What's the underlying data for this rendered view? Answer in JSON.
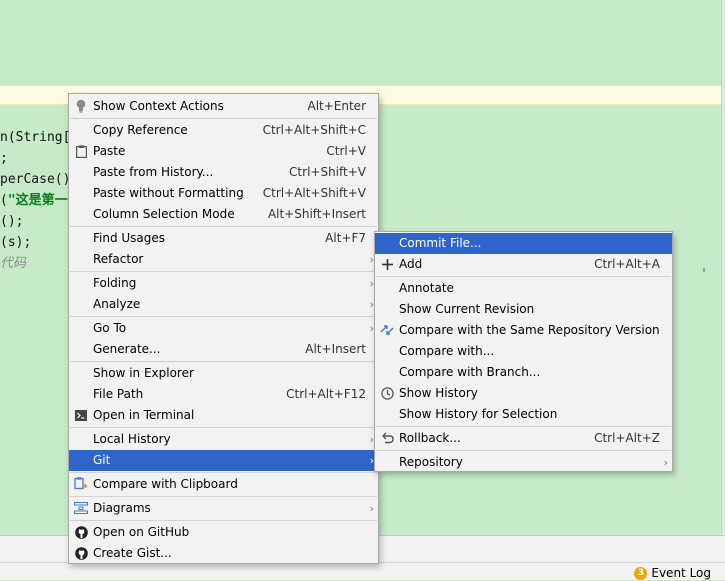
{
  "editor": {
    "code_lines": [
      {
        "text": "n(String[",
        "cls": ""
      },
      {
        "text": ";",
        "cls": ""
      },
      {
        "text": "perCase()",
        "cls": ""
      },
      {
        "pre": "(",
        "str": "\"这是第一",
        "cls": ""
      },
      {
        "text": "();",
        "cls": ""
      },
      {
        "text": "(s);",
        "cls": ""
      },
      {
        "text": "代码",
        "cls": "cmt"
      }
    ]
  },
  "context_menu": {
    "items": [
      {
        "label": "Show Context Actions",
        "shortcut": "Alt+Enter",
        "icon": "lightbulb-icon"
      },
      {
        "label": "Copy Reference",
        "shortcut": "Ctrl+Alt+Shift+C",
        "icon": ""
      },
      {
        "label": "Paste",
        "shortcut": "Ctrl+V",
        "icon": "clipboard-icon"
      },
      {
        "label": "Paste from History...",
        "shortcut": "Ctrl+Shift+V",
        "icon": ""
      },
      {
        "label": "Paste without Formatting",
        "shortcut": "Ctrl+Alt+Shift+V",
        "icon": ""
      },
      {
        "label": "Column Selection Mode",
        "shortcut": "Alt+Shift+Insert",
        "icon": ""
      },
      {
        "label": "Find Usages",
        "shortcut": "Alt+F7",
        "icon": ""
      },
      {
        "label": "Refactor",
        "shortcut": "",
        "icon": "",
        "submenu": true
      },
      {
        "label": "Folding",
        "shortcut": "",
        "icon": "",
        "submenu": true
      },
      {
        "label": "Analyze",
        "shortcut": "",
        "icon": "",
        "submenu": true
      },
      {
        "label": "Go To",
        "shortcut": "",
        "icon": "",
        "submenu": true
      },
      {
        "label": "Generate...",
        "shortcut": "Alt+Insert",
        "icon": ""
      },
      {
        "label": "Show in Explorer",
        "shortcut": "",
        "icon": ""
      },
      {
        "label": "File Path",
        "shortcut": "Ctrl+Alt+F12",
        "icon": ""
      },
      {
        "label": "Open in Terminal",
        "shortcut": "",
        "icon": "terminal-icon"
      },
      {
        "label": "Local History",
        "shortcut": "",
        "icon": "",
        "submenu": true
      },
      {
        "label": "Git",
        "shortcut": "",
        "icon": "",
        "submenu": true,
        "selected": true
      },
      {
        "label": "Compare with Clipboard",
        "shortcut": "",
        "icon": "compare-clipboard-icon"
      },
      {
        "label": "Diagrams",
        "shortcut": "",
        "icon": "diagram-icon",
        "submenu": true
      },
      {
        "label": "Open on GitHub",
        "shortcut": "",
        "icon": "github-icon"
      },
      {
        "label": "Create Gist...",
        "shortcut": "",
        "icon": "github-icon"
      }
    ]
  },
  "git_submenu": {
    "items": [
      {
        "label": "Commit File...",
        "shortcut": "",
        "icon": "",
        "selected": true
      },
      {
        "label": "Add",
        "shortcut": "Ctrl+Alt+A",
        "icon": "plus-icon"
      },
      {
        "label": "Annotate",
        "shortcut": "",
        "icon": ""
      },
      {
        "label": "Show Current Revision",
        "shortcut": "",
        "icon": ""
      },
      {
        "label": "Compare with the Same Repository Version",
        "shortcut": "",
        "icon": "compare-icon"
      },
      {
        "label": "Compare with...",
        "shortcut": "",
        "icon": ""
      },
      {
        "label": "Compare with Branch...",
        "shortcut": "",
        "icon": ""
      },
      {
        "label": "Show History",
        "shortcut": "",
        "icon": "clock-icon"
      },
      {
        "label": "Show History for Selection",
        "shortcut": "",
        "icon": ""
      },
      {
        "label": "Rollback...",
        "shortcut": "Ctrl+Alt+Z",
        "icon": "undo-icon"
      },
      {
        "label": "Repository",
        "shortcut": "",
        "icon": "",
        "submenu": true
      }
    ]
  },
  "status_bar": {
    "event_log_label": "Event Log",
    "event_count": "3"
  },
  "colors": {
    "selection": "#2f65ca",
    "editor_bg": "#c7ebc9",
    "menu_bg": "#f2f2f2"
  }
}
